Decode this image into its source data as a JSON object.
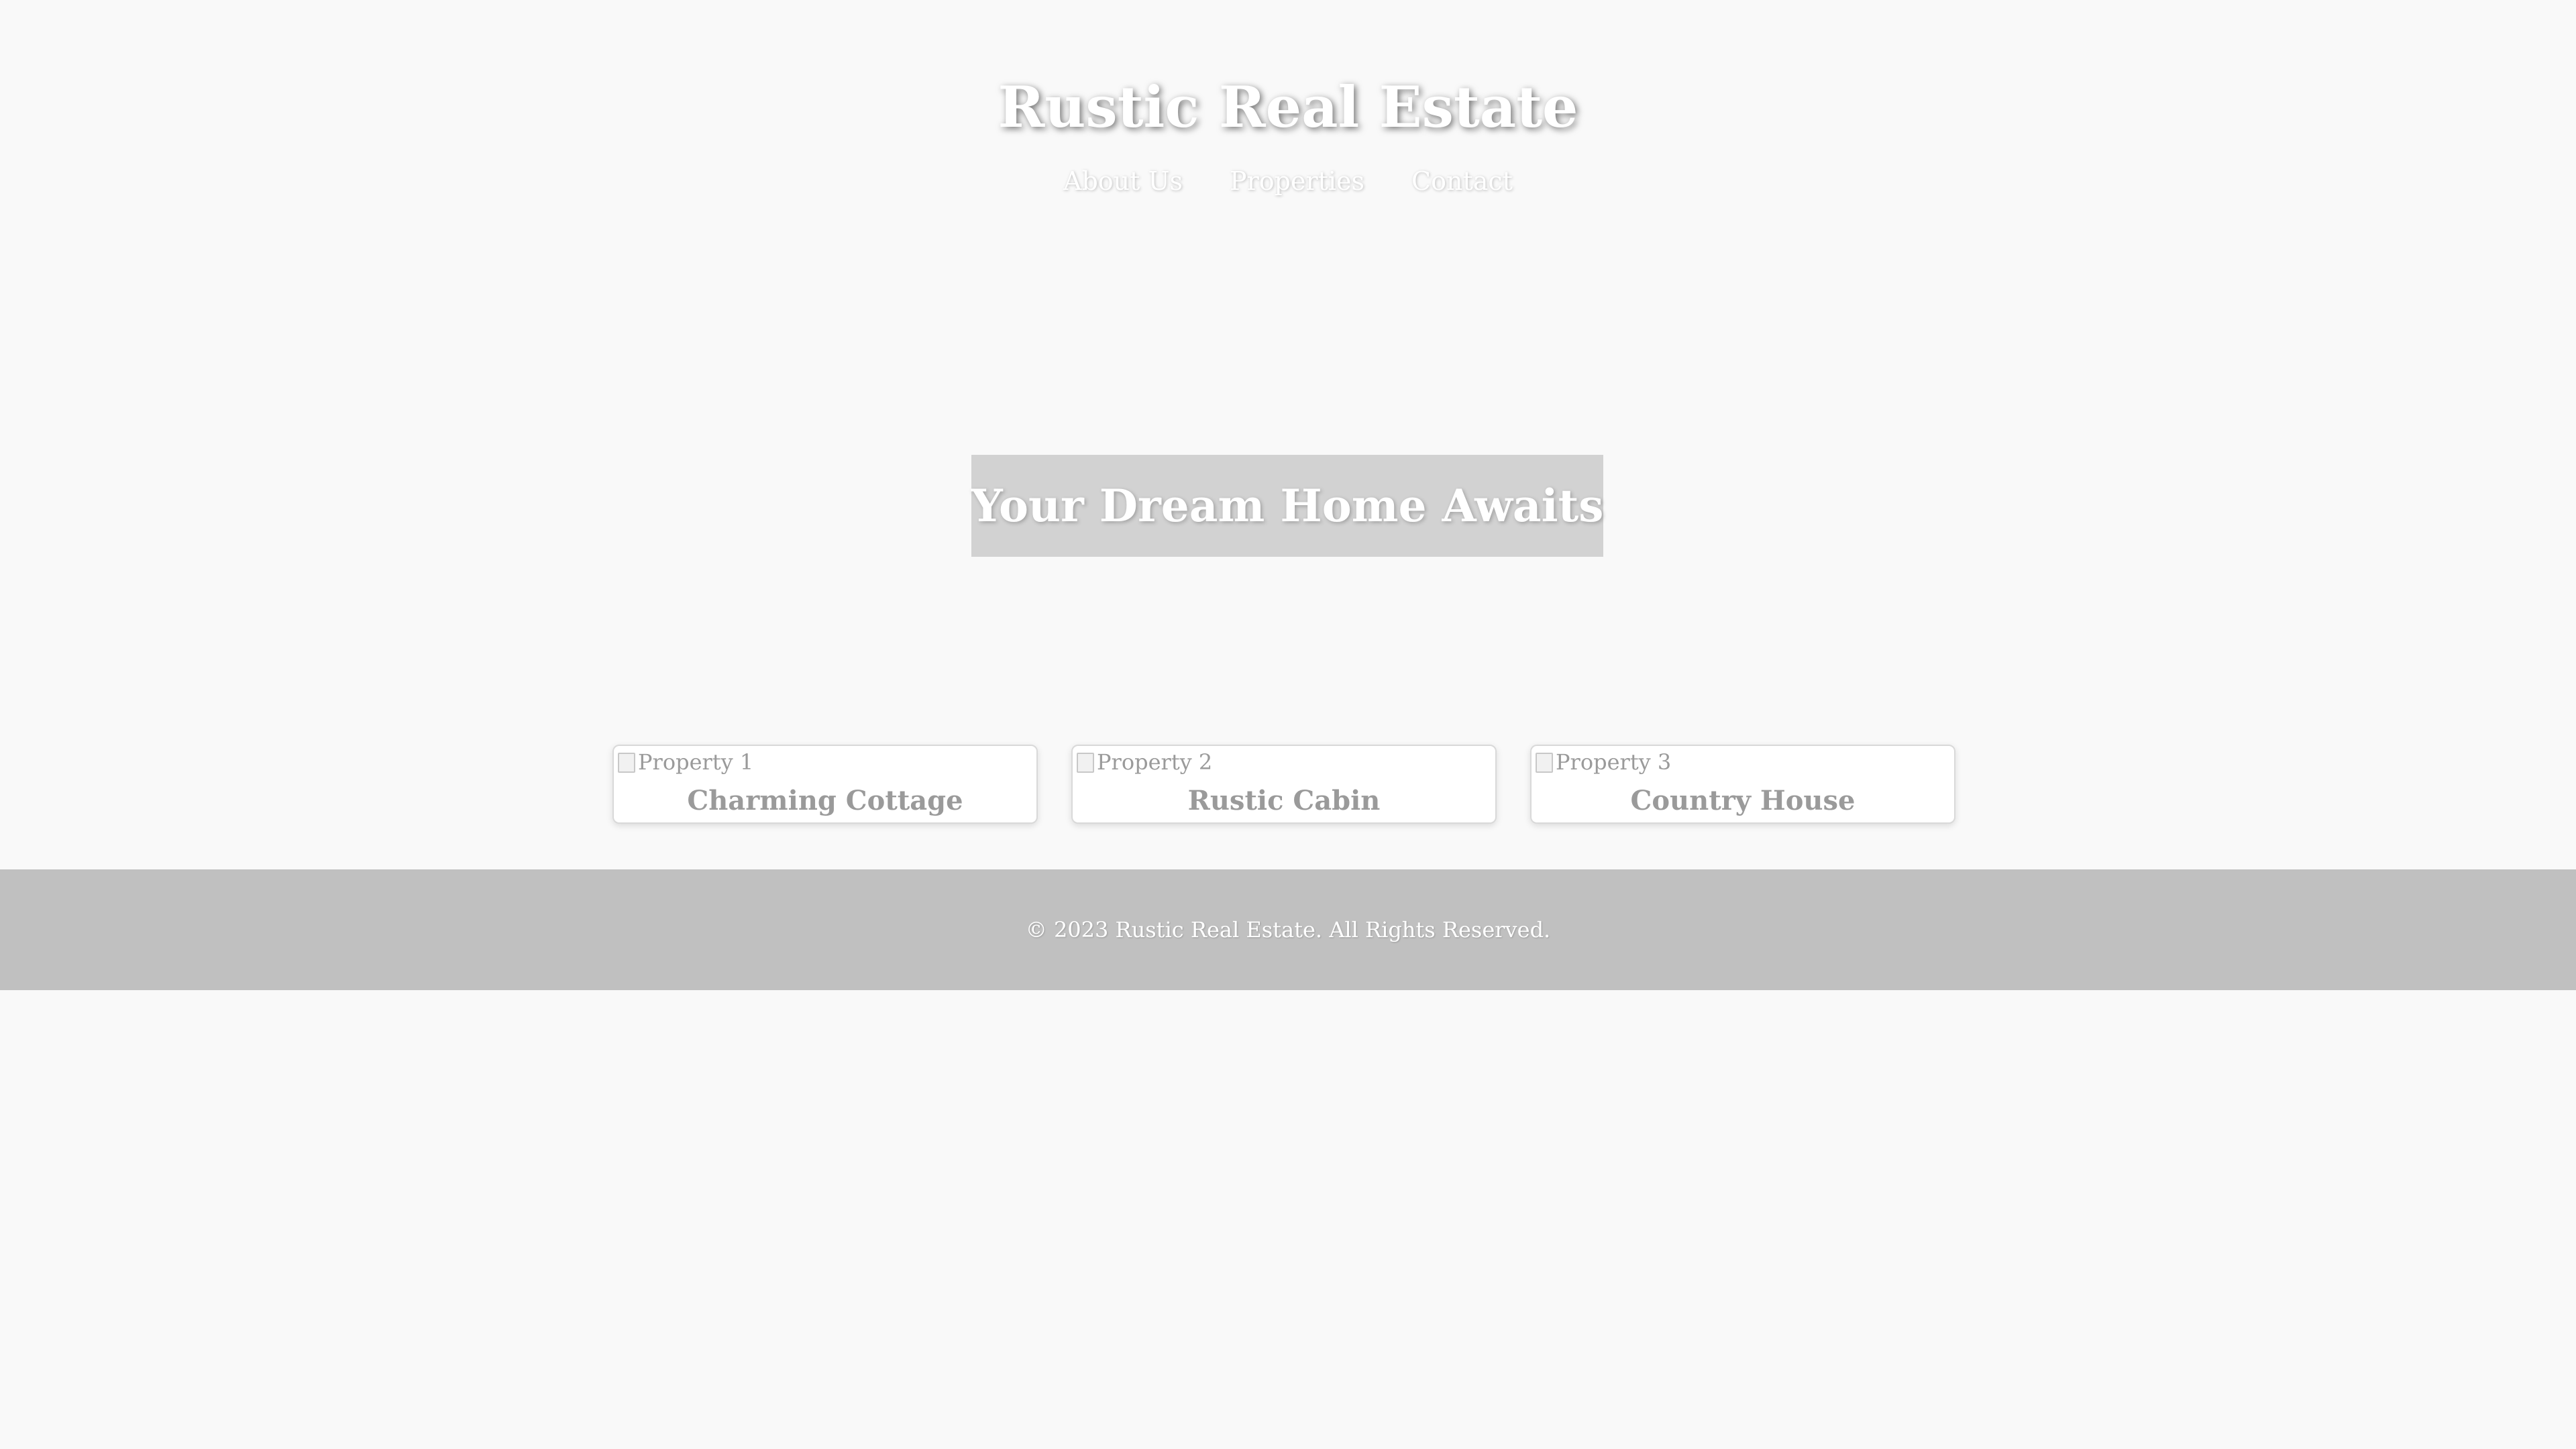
{
  "header": {
    "title": "Rustic Real Estate",
    "nav": [
      {
        "label": "About Us"
      },
      {
        "label": "Properties"
      },
      {
        "label": "Contact"
      }
    ]
  },
  "hero": {
    "title": "Your Dream Home Awaits"
  },
  "properties": [
    {
      "image_alt": "Property 1",
      "name": "Charming Cottage"
    },
    {
      "image_alt": "Property 2",
      "name": "Rustic Cabin"
    },
    {
      "image_alt": "Property 3",
      "name": "Country House"
    }
  ],
  "footer": {
    "text": "© 2023 Rustic Real Estate. All Rights Reserved."
  },
  "colors": {
    "page_background": "#f9f9f9",
    "hero_box": "#d2d2d2",
    "footer_background": "#c0c0c0",
    "card_title": "#9a9a9a"
  }
}
